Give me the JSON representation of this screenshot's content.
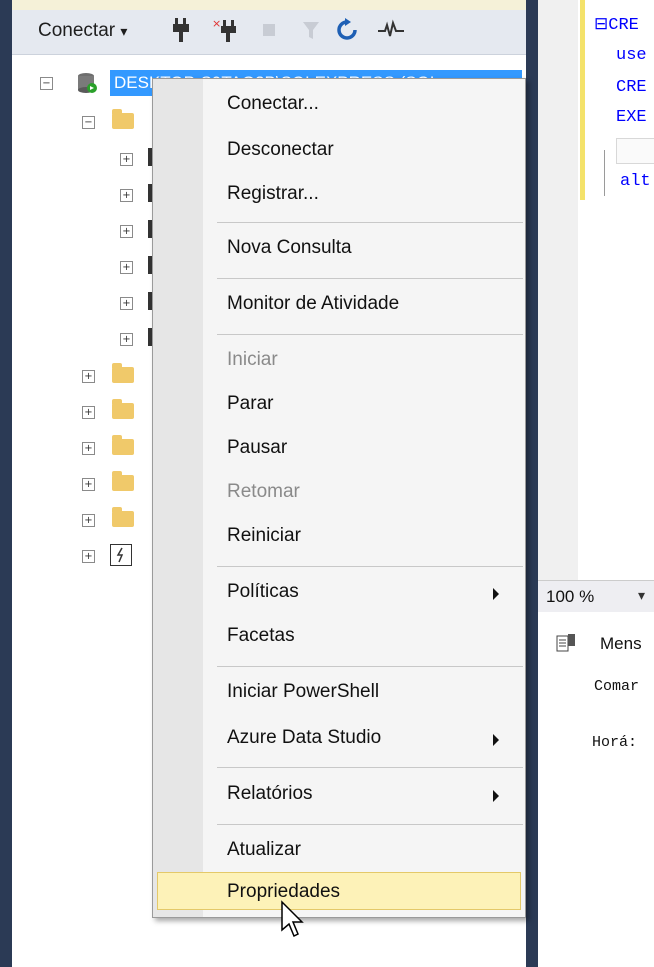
{
  "toolbar": {
    "connect_label": "Conectar",
    "connect_dropdown_glyph": "▾"
  },
  "tree": {
    "server_name": "DESKTOP-S9TAG3B\\SQLEXPRESS (SQL"
  },
  "editor": {
    "lines": [
      "⊟CRE",
      "use",
      "CRE",
      "EXE",
      "",
      "alt"
    ]
  },
  "statusbar": {
    "zoom": "100 %",
    "zoom_dropdown": "▾"
  },
  "results": {
    "tab_label": "Mens",
    "lines": [
      "Comar",
      "Horá:"
    ]
  },
  "context_menu": {
    "items": [
      {
        "label": "Conectar..."
      },
      {
        "label": "Desconectar"
      },
      {
        "label": "Registrar..."
      },
      {
        "label": "Nova Consulta"
      },
      {
        "label": "Monitor de Atividade"
      },
      {
        "label": "Iniciar"
      },
      {
        "label": "Parar"
      },
      {
        "label": "Pausar"
      },
      {
        "label": "Retomar"
      },
      {
        "label": "Reiniciar"
      },
      {
        "label": "Políticas"
      },
      {
        "label": "Facetas"
      },
      {
        "label": "Iniciar PowerShell"
      },
      {
        "label": "Azure Data Studio"
      },
      {
        "label": "Relatórios"
      },
      {
        "label": "Atualizar"
      },
      {
        "label": "Propriedades"
      }
    ]
  },
  "colors": {
    "selection": "#3399ff",
    "menu_hover": "#fdf2b8",
    "frame": "#2b3a55",
    "folder": "#f0c96a"
  }
}
